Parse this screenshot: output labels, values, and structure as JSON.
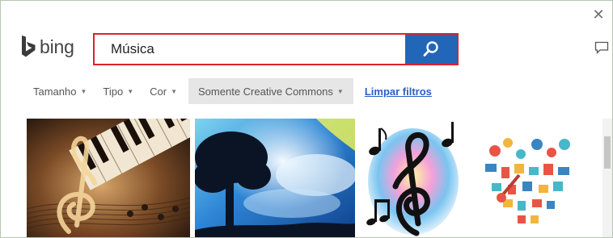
{
  "brand": {
    "logo_text": "bing"
  },
  "search": {
    "query": "Música"
  },
  "filters": {
    "items": [
      {
        "label": "Tamanho"
      },
      {
        "label": "Tipo"
      },
      {
        "label": "Cor"
      },
      {
        "label": "Somente Creative Commons",
        "active": true
      }
    ],
    "clear_label": "Limpar filtros"
  },
  "results": [
    {
      "icon": "piano-treble-clef-image"
    },
    {
      "icon": "tree-blue-sky-image"
    },
    {
      "icon": "treble-clef-notes-image"
    },
    {
      "icon": "music-icons-heart-image"
    }
  ],
  "colors": {
    "accent": "#2266b8",
    "highlight_border": "#e0202c",
    "link": "#2b60c3"
  }
}
